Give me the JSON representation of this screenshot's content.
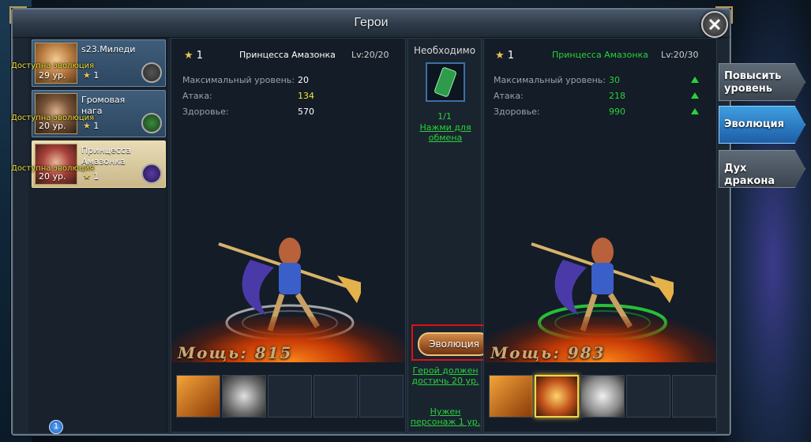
{
  "window": {
    "title": "Герои"
  },
  "hero_list": [
    {
      "name": "s23.Миледи",
      "level": "29 ур.",
      "stars": "1",
      "evo_note": "Доступна эволюция",
      "role_icon": "helmet-icon"
    },
    {
      "name": "Громовая нага",
      "level": "20 ур.",
      "stars": "1",
      "evo_note": "Доступна эволюция",
      "role_icon": "potion-icon"
    },
    {
      "name": "Принцесса Амазонка",
      "level": "20 ур.",
      "stars": "1",
      "evo_note": "Доступна эволюция",
      "role_icon": "shield-icon"
    }
  ],
  "current": {
    "stars": "1",
    "name": "Принцесса Амазонка",
    "lv": "Lv:20/20",
    "stats": [
      {
        "label": "Максимальный уровень:",
        "value": "20"
      },
      {
        "label": "Атака:",
        "value": "134"
      },
      {
        "label": "Здоровье:",
        "value": "570"
      }
    ],
    "power": "Мощь: 815"
  },
  "evolved": {
    "stars": "1",
    "name": "Принцесса Амазонка",
    "lv": "Lv:20/30",
    "stats": [
      {
        "label": "Максимальный уровень:",
        "value": "30"
      },
      {
        "label": "Атака:",
        "value": "218"
      },
      {
        "label": "Здоровье:",
        "value": "990"
      }
    ],
    "power": "Мощь: 983"
  },
  "requirements": {
    "title": "Необходимо",
    "item_count": "1/1",
    "swap_link": "Нажми для обмена",
    "evolve_button": "Эволюция",
    "note1": "Герой должен достичь 20 ур.",
    "note2": "Нужен персонаж 1 ур."
  },
  "side_tabs": [
    {
      "label": "Повысить уровень",
      "active": false
    },
    {
      "label": "Эволюция",
      "active": true
    },
    {
      "label": "Дух дракона",
      "active": false
    }
  ],
  "notification_badge": "1",
  "colors": {
    "green": "#29d23a",
    "yellow": "#f3e23a",
    "accent_blue": "#3f9ee0"
  }
}
